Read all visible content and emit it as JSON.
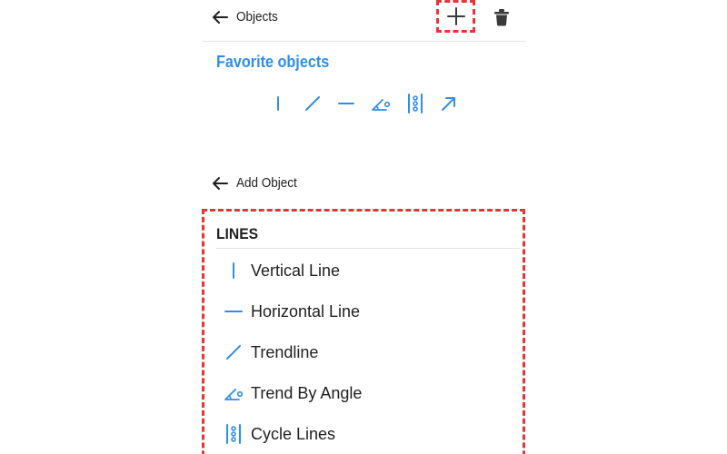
{
  "objects_header": {
    "title": "Objects"
  },
  "favorites": {
    "title": "Favorite objects",
    "icons": [
      "vertical-line-icon",
      "trendline-icon",
      "horizontal-line-icon",
      "trend-by-angle-icon",
      "cycle-lines-icon",
      "arrow-icon"
    ]
  },
  "add_object_header": {
    "title": "Add Object"
  },
  "lines_section": {
    "header": "LINES",
    "items": [
      {
        "label": "Vertical Line",
        "icon": "vertical-line-icon"
      },
      {
        "label": "Horizontal Line",
        "icon": "horizontal-line-icon"
      },
      {
        "label": "Trendline",
        "icon": "trendline-icon"
      },
      {
        "label": "Trend By Angle",
        "icon": "trend-by-angle-icon"
      },
      {
        "label": "Cycle Lines",
        "icon": "cycle-lines-icon"
      }
    ]
  },
  "colors": {
    "accent": "#2f8eeb",
    "highlight": "#e8333a",
    "text": "#1f1f1f"
  }
}
